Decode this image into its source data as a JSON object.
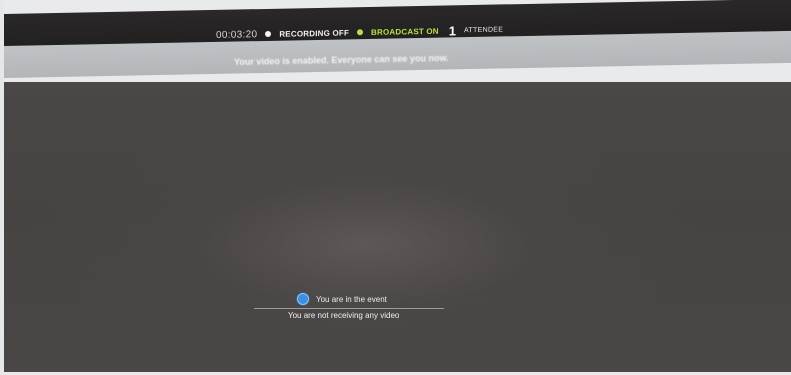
{
  "topbar": {
    "timer": "00:03:20",
    "recording_status": "RECORDING OFF",
    "broadcast_status": "BROADCAST ON",
    "attendee_count": "1",
    "attendee_label": "ATTENDEE"
  },
  "notice": {
    "message": "Your video is enabled. Everyone can see you now."
  },
  "event_status": {
    "joined_text": "You are in the event",
    "video_text": "You are not receiving any video"
  },
  "colors": {
    "broadcast_on": "#b8e04a",
    "status_icon": "#3d8fe0",
    "video_background": "#4b4746"
  },
  "icons": {
    "recording_status": "status-dot-icon",
    "broadcast_status": "status-dot-icon",
    "event_status": "check-circle-icon"
  }
}
